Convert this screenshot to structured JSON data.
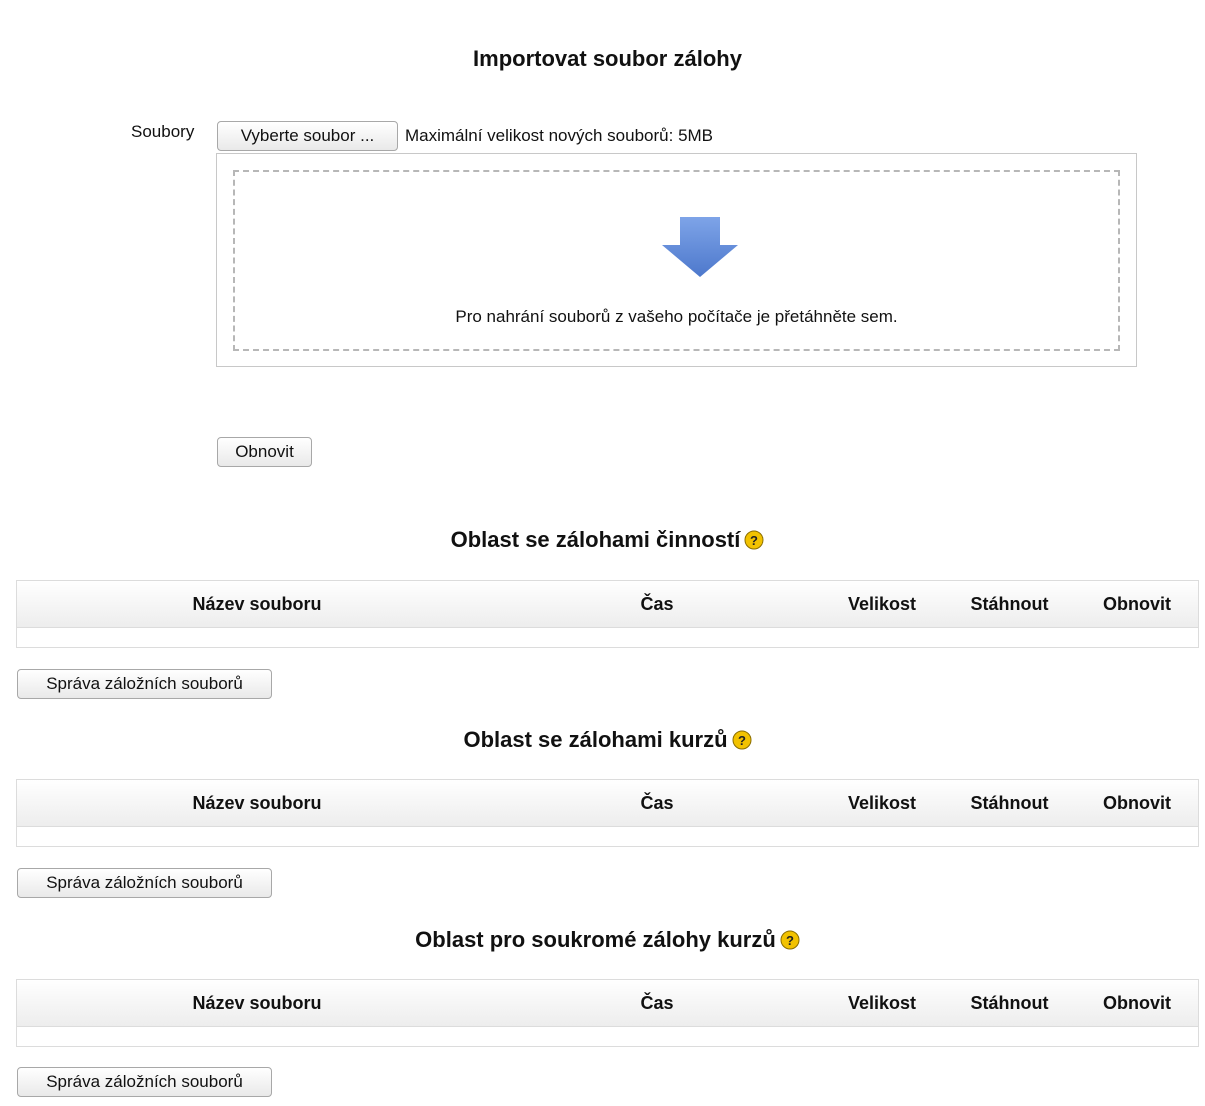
{
  "import": {
    "title": "Importovat soubor zálohy",
    "files_label": "Soubory",
    "choose_button": "Vyberte soubor ...",
    "max_size": "Maximální velikost nových souborů: 5MB",
    "drop_text": "Pro nahrání souborů z vašeho počítače je přetáhněte sem.",
    "restore_button": "Obnovit",
    "drop_arrow_icon": "download-arrow-icon",
    "arrow_color": "#5b86d6"
  },
  "columns": {
    "name": "Název souboru",
    "time": "Čas",
    "size": "Velikost",
    "download": "Stáhnout",
    "restore": "Obnovit"
  },
  "sections": [
    {
      "title": "Oblast se zálohami činností",
      "help_icon": "help-icon",
      "manage_button": "Správa záložních souborů",
      "rows": []
    },
    {
      "title": "Oblast se zálohami kurzů",
      "help_icon": "help-icon",
      "manage_button": "Správa záložních souborů",
      "rows": []
    },
    {
      "title": "Oblast pro soukromé zálohy kurzů",
      "help_icon": "help-icon",
      "manage_button": "Správa záložních souborů",
      "rows": []
    }
  ],
  "colors": {
    "help_icon_fill": "#f2c200",
    "border": "#dcdcdc"
  }
}
